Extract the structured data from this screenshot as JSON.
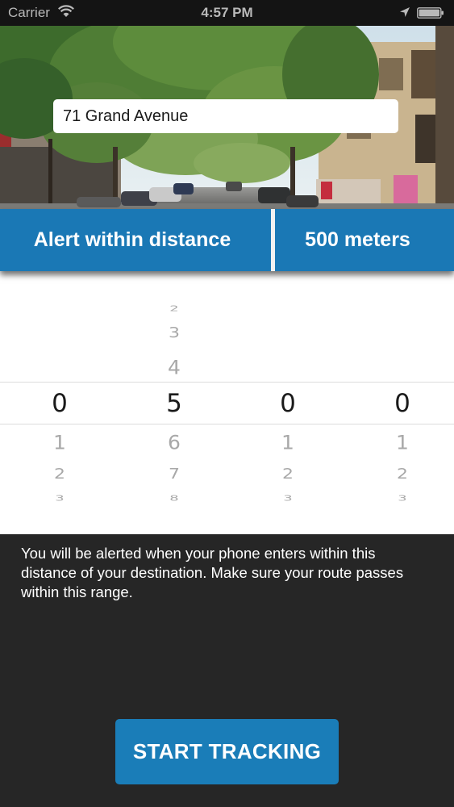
{
  "status_bar": {
    "carrier": "Carrier",
    "time": "4:57 PM",
    "icons": [
      "wifi-icon",
      "location-arrow-icon",
      "battery-icon"
    ]
  },
  "header": {
    "address_value": "71 Grand Avenue",
    "background": "street-photo"
  },
  "alert": {
    "label": "Alert within distance",
    "value": "500 meters",
    "color": "#1a78b5"
  },
  "picker": {
    "selected_value": "0500",
    "columns": [
      {
        "above": [],
        "selected": "0",
        "below": [
          "1",
          "2",
          "3"
        ]
      },
      {
        "above": [
          "2",
          "3",
          "4"
        ],
        "selected": "5",
        "below": [
          "6",
          "7",
          "8"
        ]
      },
      {
        "above": [],
        "selected": "0",
        "below": [
          "1",
          "2",
          "3"
        ]
      },
      {
        "above": [],
        "selected": "0",
        "below": [
          "1",
          "2",
          "3"
        ]
      }
    ]
  },
  "info_text": "You will be alerted when your phone enters within this distance of your destination. Make sure your route passes within this range.",
  "start_button": {
    "label": "START TRACKING",
    "color": "#1a7db8"
  }
}
